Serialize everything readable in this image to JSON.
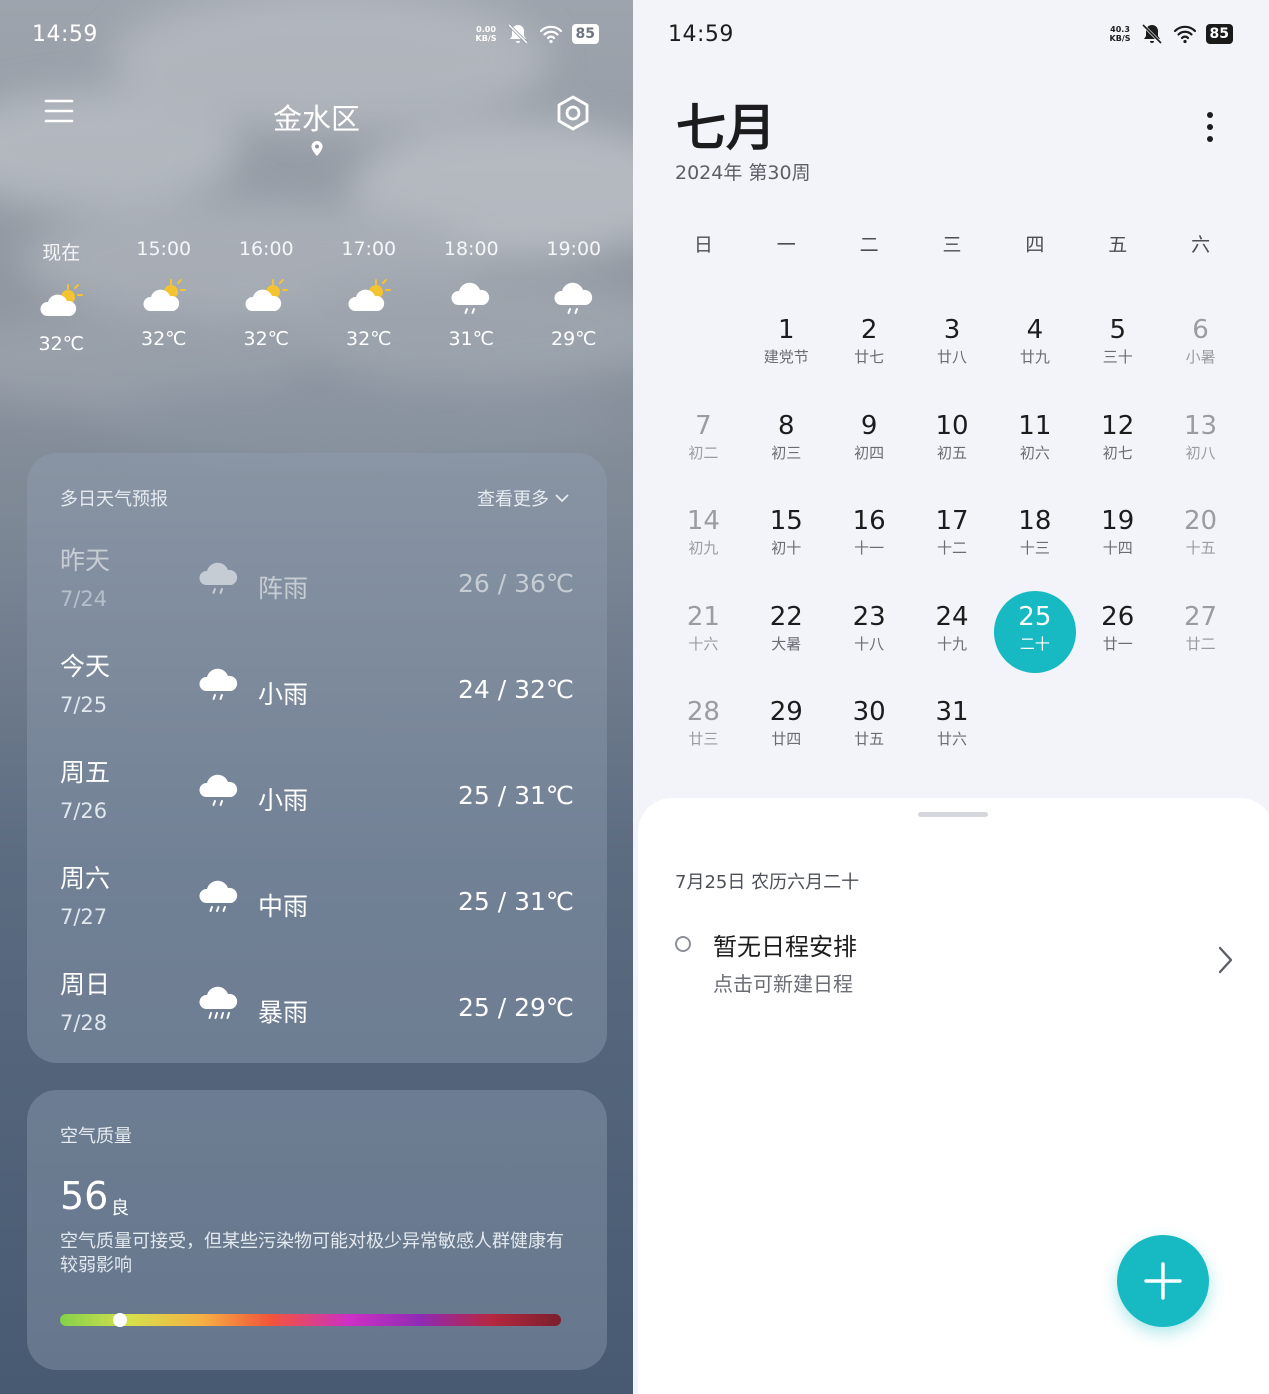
{
  "weather": {
    "status_bar": {
      "time": "14:59",
      "speed_value": "0.00",
      "speed_unit": "KB/S",
      "battery": "85"
    },
    "city": "金水区",
    "hourly": [
      {
        "time": "现在",
        "icon": "partly-cloudy-sun-icon",
        "temp": "32℃"
      },
      {
        "time": "15:00",
        "icon": "partly-cloudy-sun-icon",
        "temp": "32℃"
      },
      {
        "time": "16:00",
        "icon": "partly-cloudy-sun-icon",
        "temp": "32℃"
      },
      {
        "time": "17:00",
        "icon": "partly-cloudy-sun-icon",
        "temp": "32℃"
      },
      {
        "time": "18:00",
        "icon": "rain-cloud-icon",
        "temp": "31℃"
      },
      {
        "time": "19:00",
        "icon": "rain-cloud-icon",
        "temp": "29℃"
      }
    ],
    "forecast": {
      "title": "多日天气预报",
      "more_label": "查看更多",
      "days": [
        {
          "day": "昨天",
          "date": "7/24",
          "icon": "shower-cloud-icon",
          "condition": "阵雨",
          "temp": "26 / 36℃"
        },
        {
          "day": "今天",
          "date": "7/25",
          "icon": "light-rain-cloud-icon",
          "condition": "小雨",
          "temp": "24 / 32℃"
        },
        {
          "day": "周五",
          "date": "7/26",
          "icon": "light-rain-cloud-icon",
          "condition": "小雨",
          "temp": "25 / 31℃"
        },
        {
          "day": "周六",
          "date": "7/27",
          "icon": "moderate-rain-cloud-icon",
          "condition": "中雨",
          "temp": "25 / 31℃"
        },
        {
          "day": "周日",
          "date": "7/28",
          "icon": "heavy-rain-cloud-icon",
          "condition": "暴雨",
          "temp": "25 / 29℃"
        }
      ]
    },
    "air_quality": {
      "title": "空气质量",
      "value": "56",
      "level": "良",
      "description": "空气质量可接受，但某些污染物可能对极少异常敏感人群健康有较弱影响",
      "aqi_fraction": 0.12
    }
  },
  "calendar": {
    "status_bar": {
      "time": "14:59",
      "speed_value": "40.3",
      "speed_unit": "KB/S",
      "battery": "85"
    },
    "month": "七月",
    "subtitle": "2024年 第30周",
    "weekdays": [
      "日",
      "一",
      "二",
      "三",
      "四",
      "五",
      "六"
    ],
    "first_weekday_index": 1,
    "selected_day": 25,
    "days": [
      {
        "num": "1",
        "lunar": "建党节"
      },
      {
        "num": "2",
        "lunar": "廿七"
      },
      {
        "num": "3",
        "lunar": "廿八"
      },
      {
        "num": "4",
        "lunar": "廿九"
      },
      {
        "num": "5",
        "lunar": "三十"
      },
      {
        "num": "6",
        "lunar": "小暑"
      },
      {
        "num": "7",
        "lunar": "初二"
      },
      {
        "num": "8",
        "lunar": "初三"
      },
      {
        "num": "9",
        "lunar": "初四"
      },
      {
        "num": "10",
        "lunar": "初五"
      },
      {
        "num": "11",
        "lunar": "初六"
      },
      {
        "num": "12",
        "lunar": "初七"
      },
      {
        "num": "13",
        "lunar": "初八"
      },
      {
        "num": "14",
        "lunar": "初九"
      },
      {
        "num": "15",
        "lunar": "初十"
      },
      {
        "num": "16",
        "lunar": "十一"
      },
      {
        "num": "17",
        "lunar": "十二"
      },
      {
        "num": "18",
        "lunar": "十三"
      },
      {
        "num": "19",
        "lunar": "十四"
      },
      {
        "num": "20",
        "lunar": "十五"
      },
      {
        "num": "21",
        "lunar": "十六"
      },
      {
        "num": "22",
        "lunar": "大暑"
      },
      {
        "num": "23",
        "lunar": "十八"
      },
      {
        "num": "24",
        "lunar": "十九"
      },
      {
        "num": "25",
        "lunar": "二十"
      },
      {
        "num": "26",
        "lunar": "廿一"
      },
      {
        "num": "27",
        "lunar": "廿二"
      },
      {
        "num": "28",
        "lunar": "廿三"
      },
      {
        "num": "29",
        "lunar": "廿四"
      },
      {
        "num": "30",
        "lunar": "廿五"
      },
      {
        "num": "31",
        "lunar": "廿六"
      }
    ],
    "schedule": {
      "date_label": "7月25日 农历六月二十",
      "empty_title": "暂无日程安排",
      "empty_hint": "点击可新建日程"
    },
    "accent_color": "#17b9c2"
  }
}
